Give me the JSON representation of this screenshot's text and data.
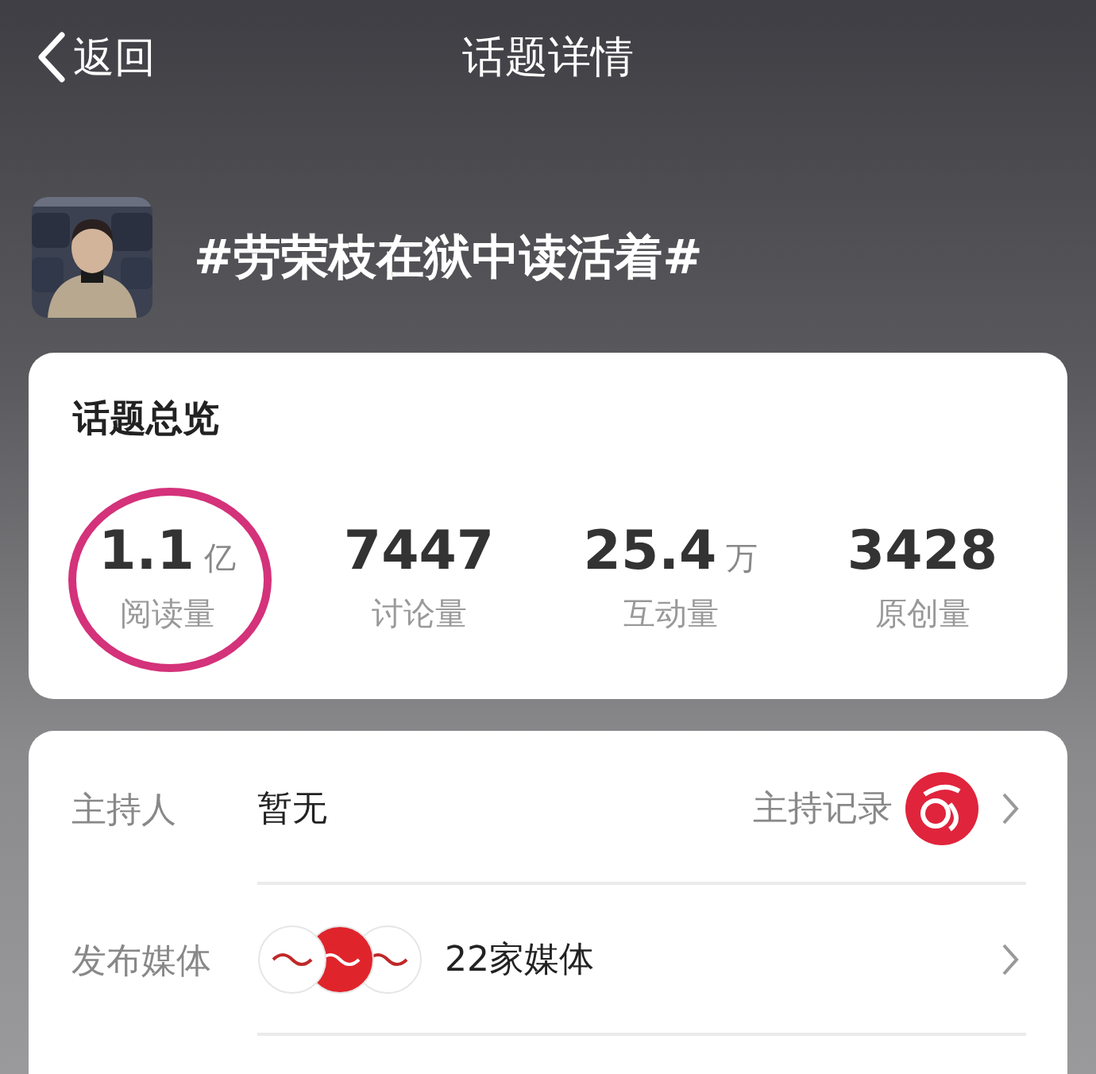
{
  "header": {
    "back": "返回",
    "title": "话题详情"
  },
  "topic": {
    "title": "#劳荣枝在狱中读活着#"
  },
  "overview": {
    "title": "话题总览",
    "stats": [
      {
        "value": "1.1",
        "unit": "亿",
        "label": "阅读量",
        "circled": true
      },
      {
        "value": "7447",
        "label": "讨论量",
        "circled": false
      },
      {
        "value": "25.4",
        "unit": "万",
        "label": "互动量",
        "circled": false
      },
      {
        "value": "3428",
        "label": "原创量",
        "circled": false
      }
    ]
  },
  "info_rows": [
    {
      "kind": "host",
      "label": "主持人",
      "value": "暂无",
      "link": "主持记录"
    },
    {
      "kind": "media",
      "label": "发布媒体",
      "value": "22家媒体"
    }
  ]
}
